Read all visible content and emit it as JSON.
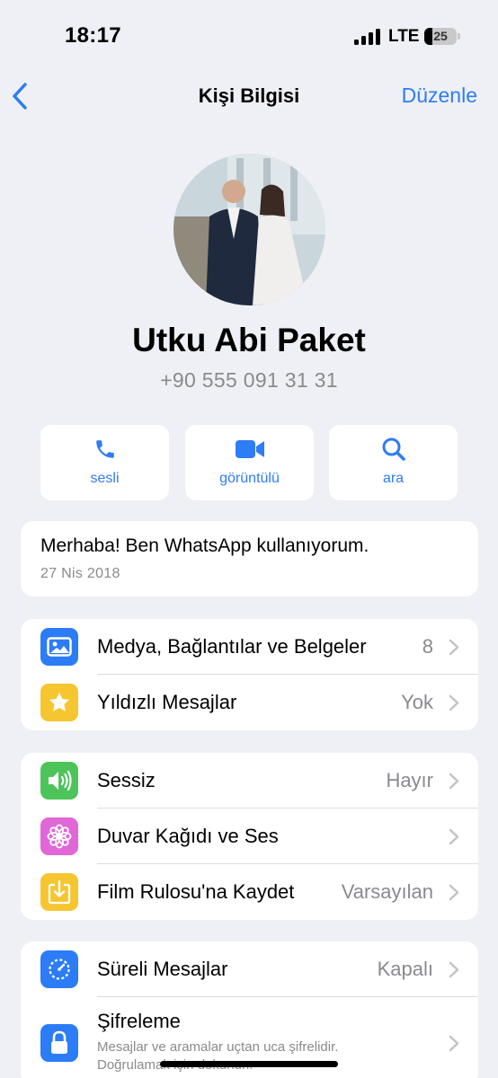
{
  "status_bar": {
    "time": "18:17",
    "network": "LTE",
    "battery": "25",
    "battery_level": 0.25
  },
  "nav": {
    "title": "Kişi Bilgisi",
    "edit_label": "Düzenle"
  },
  "contact": {
    "name": "Utku Abi Paket",
    "phone": "+90 555 091 31 31"
  },
  "actions": [
    {
      "label": "sesli",
      "icon": "phone-icon"
    },
    {
      "label": "görüntülü",
      "icon": "video-camera-icon"
    },
    {
      "label": "ara",
      "icon": "search-icon"
    }
  ],
  "about": {
    "text": "Merhaba! Ben WhatsApp kullanıyorum.",
    "date": "27 Nis 2018"
  },
  "group1": [
    {
      "label": "Medya, Bağlantılar ve Belgeler",
      "value": "8",
      "icon": "photo-icon",
      "color": "#2b7cf6"
    },
    {
      "label": "Yıldızlı Mesajlar",
      "value": "Yok",
      "icon": "star-icon",
      "color": "#f6c630"
    }
  ],
  "group2": [
    {
      "label": "Sessiz",
      "value": "Hayır",
      "icon": "speaker-icon",
      "color": "#4dc45a"
    },
    {
      "label": "Duvar Kağıdı ve Ses",
      "value": "",
      "icon": "flower-icon",
      "color": "#e067d5"
    },
    {
      "label": "Film Rulosu'na Kaydet",
      "value": "Varsayılan",
      "icon": "download-icon",
      "color": "#f6c630"
    }
  ],
  "group3": [
    {
      "label": "Süreli Mesajlar",
      "value": "Kapalı",
      "icon": "timer-icon",
      "color": "#2b7cf6"
    },
    {
      "label": "Şifreleme",
      "subtitle": "Mesajlar ve aramalar uçtan uca şifrelidir. Doğrulamak için dokunun.",
      "icon": "lock-icon",
      "color": "#2b7cf6"
    }
  ]
}
